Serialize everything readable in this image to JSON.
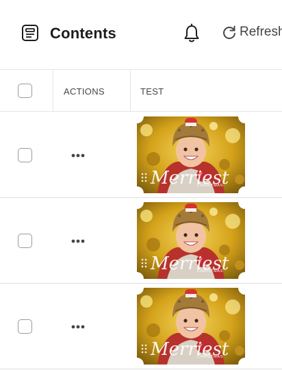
{
  "header": {
    "title": "Contents",
    "refresh_label": "Refresh",
    "icons": {
      "page": "document-icon",
      "notifications": "bell-icon",
      "refresh": "refresh-icon"
    }
  },
  "table": {
    "columns": [
      {
        "key": "select",
        "label": ""
      },
      {
        "key": "actions",
        "label": "ACTIONS"
      },
      {
        "key": "test",
        "label": "TEST"
      }
    ],
    "rows": [
      {
        "image_text": "Merriest",
        "image_subtext": "CHRISTMAS"
      },
      {
        "image_text": "Merriest",
        "image_subtext": "CHRISTMAS"
      },
      {
        "image_text": "Merriest",
        "image_subtext": "CHRISTMAS"
      }
    ]
  },
  "colors": {
    "text": "#1c1c1c",
    "border": "#e4e4e4",
    "gold": "#d4a21a",
    "hat_red": "#d8322e"
  }
}
